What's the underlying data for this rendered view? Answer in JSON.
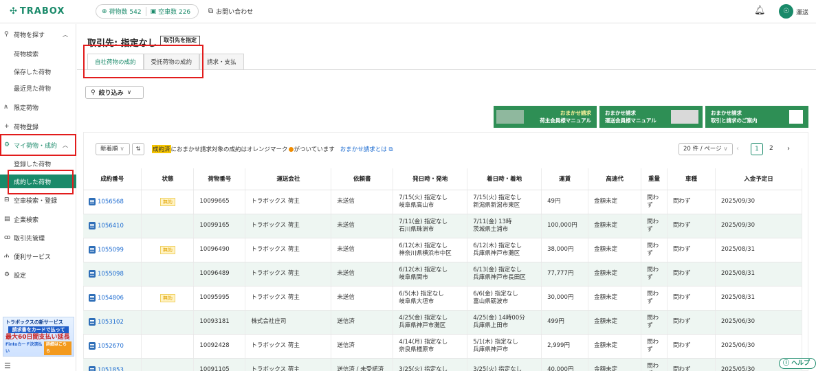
{
  "header": {
    "logo": "TRABOX",
    "logo_icon": "sparkle-icon",
    "cargo_count": "荷物数 542",
    "vehicle_count": "空車数 226",
    "contact": "お問い合わせ",
    "user": "運送"
  },
  "sidebar": {
    "items": [
      {
        "label": "荷物を探す",
        "icon": "search-icon",
        "type": "parent"
      },
      {
        "label": "荷物検索",
        "type": "sub"
      },
      {
        "label": "保存した荷物",
        "type": "sub"
      },
      {
        "label": "最近見た荷物",
        "type": "sub"
      },
      {
        "label": "限定荷物",
        "icon": "people-icon",
        "type": "top"
      },
      {
        "label": "荷物登録",
        "icon": "plus-icon",
        "type": "top"
      },
      {
        "label": "マイ荷物・成約",
        "icon": "gear-icon",
        "type": "parent"
      },
      {
        "label": "登録した荷物",
        "type": "sub"
      },
      {
        "label": "成約した荷物",
        "type": "sub"
      },
      {
        "label": "空車検索・登録",
        "icon": "truck-icon",
        "type": "top"
      },
      {
        "label": "企業検索",
        "icon": "building-icon",
        "type": "top"
      },
      {
        "label": "取引先管理",
        "icon": "handshake-icon",
        "type": "top"
      },
      {
        "label": "便利サービス",
        "icon": "service-icon",
        "type": "top"
      },
      {
        "label": "設定",
        "icon": "settings-icon",
        "type": "top"
      }
    ],
    "banner": {
      "line1": "トラボックスの新サービス",
      "line2": "請求書をカードで払って",
      "line3": "最大60日間支払い延長",
      "line4a": "Fintoカード決済払い",
      "line4b": "詳細はこちら"
    }
  },
  "main": {
    "title": "取引先: 指定なし",
    "specify_button": "取引先を指定",
    "tabs": [
      "自社荷物の成約",
      "受託荷物の成約",
      "請求・支払"
    ],
    "filter": "絞り込み",
    "banners": [
      {
        "l1": "おまかせ請求",
        "l2": "荷主会員様マニュアル"
      },
      {
        "l1": "おまかせ請求",
        "l2": "運送会員様マニュアル"
      },
      {
        "l1": "おまかせ請求",
        "l2": "取引と請求のご案内"
      }
    ],
    "sort": "新着順",
    "sort_dir": "⇅",
    "note_hl": "成約済",
    "note_a": "におまかせ請求対象の成約はオレンジマーク",
    "note_b": "がついています",
    "note_link": "おまかせ請求とは",
    "per_page": "20 件 / ページ",
    "page1": "1",
    "page2": "2",
    "help": "ヘルプ"
  },
  "table": {
    "headers": [
      "成約番号",
      "状態",
      "荷物番号",
      "運送会社",
      "依頼書",
      "発日時・発地",
      "着日時・着地",
      "運賃",
      "高速代",
      "重量",
      "車種",
      "入金予定日"
    ],
    "rows": [
      [
        "1056568",
        "無効",
        "10099665",
        "トラボックス 荷主",
        "未送信",
        "7/15(火) 指定なし",
        "岐阜県高山市",
        "7/15(火) 指定なし",
        "新潟県新潟市東区",
        "49円",
        "金額未定",
        "問わず",
        "問わず",
        "2025/09/30"
      ],
      [
        "1056410",
        "",
        "10099165",
        "トラボックス 荷主",
        "未送信",
        "7/11(金) 指定なし",
        "石川県珠洲市",
        "7/11(金) 13時",
        "茨城県土浦市",
        "100,000円",
        "金額未定",
        "問わず",
        "問わず",
        "2025/09/30"
      ],
      [
        "1055099",
        "無効",
        "10096490",
        "トラボックス 荷主",
        "未送信",
        "6/12(木) 指定なし",
        "神奈川県横浜市中区",
        "6/12(木) 指定なし",
        "兵庫県神戸市灘区",
        "38,000円",
        "金額未定",
        "問わず",
        "問わず",
        "2025/08/31"
      ],
      [
        "1055098",
        "",
        "10096489",
        "トラボックス 荷主",
        "未送信",
        "6/12(木) 指定なし",
        "岐阜県関市",
        "6/13(金) 指定なし",
        "兵庫県神戸市長田区",
        "77,777円",
        "金額未定",
        "問わず",
        "問わず",
        "2025/08/31"
      ],
      [
        "1054806",
        "無効",
        "10095995",
        "トラボックス 荷主",
        "未送信",
        "6/5(木) 指定なし",
        "岐阜県大垣市",
        "6/6(金) 指定なし",
        "富山県砺波市",
        "30,000円",
        "金額未定",
        "問わず",
        "問わず",
        "2025/08/31"
      ],
      [
        "1053102",
        "",
        "10093181",
        "株式会社庄司",
        "送信済",
        "4/25(金) 指定なし",
        "兵庫県神戸市灘区",
        "4/25(金) 14時00分",
        "兵庫県上田市",
        "499円",
        "金額未定",
        "問わず",
        "問わず",
        "2025/06/30"
      ],
      [
        "1052670",
        "",
        "10092428",
        "トラボックス 荷主",
        "送信済",
        "4/14(月) 指定なし",
        "奈良県橿原市",
        "5/1(木) 指定なし",
        "兵庫県神戸市",
        "2,999円",
        "金額未定",
        "問わず",
        "問わず",
        "2025/06/30"
      ],
      [
        "1051853",
        "",
        "10091105",
        "トラボックス 荷主",
        "送信済 / 未受諾済",
        "3/25(火) 指定なし",
        "",
        "3/25(火) 指定なし",
        "",
        "40,000円",
        "金額未定",
        "問わず",
        "問わず",
        "2025/05/30"
      ]
    ]
  }
}
